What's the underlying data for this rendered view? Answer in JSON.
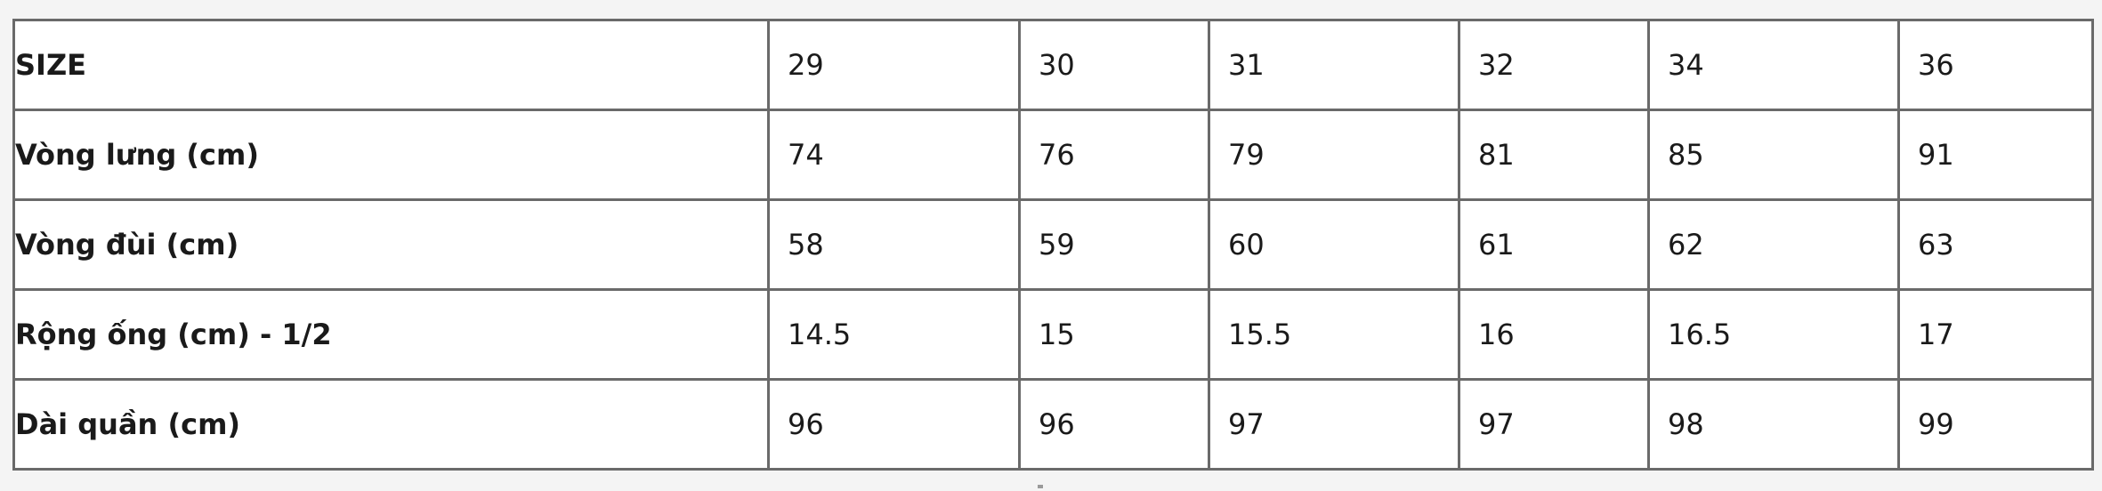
{
  "size_table": {
    "rows": [
      {
        "label": "SIZE",
        "values": [
          "29",
          "30",
          "31",
          "32",
          "34",
          "36"
        ]
      },
      {
        "label": "Vòng lưng (cm)",
        "values": [
          "74",
          "76",
          "79",
          "81",
          "85",
          "91"
        ]
      },
      {
        "label": "Vòng đùi (cm)",
        "values": [
          "58",
          "59",
          "60",
          "61",
          "62",
          "63"
        ]
      },
      {
        "label": "Rộng ống (cm) - 1/2",
        "values": [
          "14.5",
          "15",
          "15.5",
          "16",
          "16.5",
          "17"
        ]
      },
      {
        "label": "Dài quần (cm)",
        "values": [
          "96",
          "96",
          "97",
          "97",
          "98",
          "99"
        ]
      }
    ]
  }
}
